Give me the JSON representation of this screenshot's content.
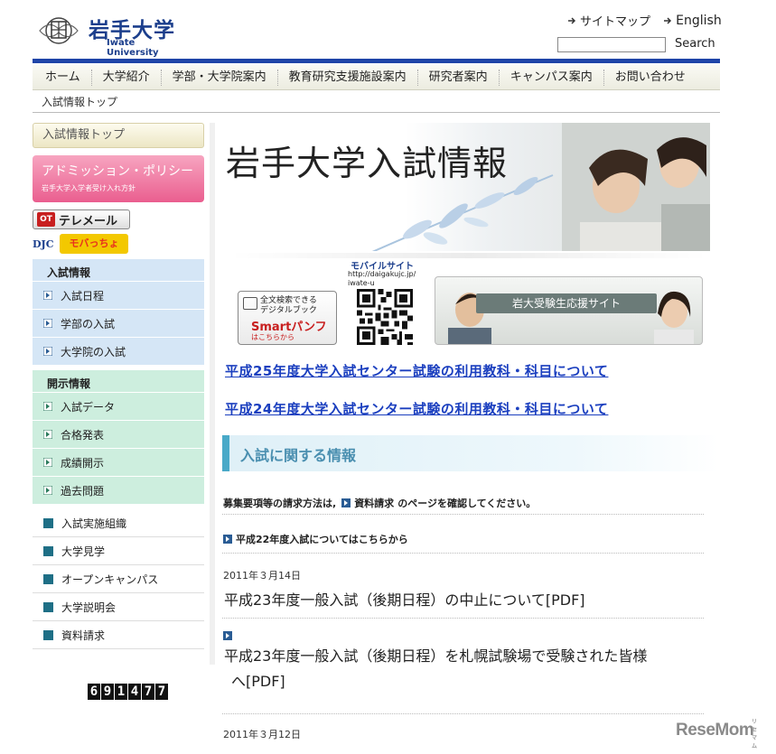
{
  "header": {
    "logo_jp": "岩手大学",
    "logo_en": "Iwate University",
    "links": [
      "サイトマップ",
      "English"
    ],
    "search_label": "Search"
  },
  "gnav": [
    "ホーム",
    "大学紹介",
    "学部・大学院案内",
    "教育研究支援施設案内",
    "研究者案内",
    "キャンパス案内",
    "お問い合わせ"
  ],
  "breadcrumb": "入試情報トップ",
  "sidebar": {
    "top": "入試情報トップ",
    "policy_title": "アドミッション・ポリシー",
    "policy_sub": "岩手大学入学者受け入れ方針",
    "telemail_icon": "OT",
    "telemail": "テレメール",
    "djc": "DJC",
    "mobile_logo": "モバっちょ",
    "group1": {
      "head": "入試情報",
      "items": [
        "入試日程",
        "学部の入試",
        "大学院の入試"
      ]
    },
    "group2": {
      "head": "開示情報",
      "items": [
        "入試データ",
        "合格発表",
        "成績開示",
        "過去問題"
      ]
    },
    "plain": [
      "入試実施組織",
      "大学見学",
      "オープンキャンパス",
      "大学説明会",
      "資料請求"
    ],
    "counter": [
      "6",
      "9",
      "1",
      "4",
      "7",
      "7"
    ]
  },
  "main": {
    "hero_title": "岩手大学入試情報",
    "qr_label": "モバイルサイト",
    "qr_url_1": "http://daigakujc.jp/",
    "qr_url_2": "iwate-u",
    "smart_line1": "全文検索できる",
    "smart_line2": "デジタルブック",
    "smart_title": "Smartパンフ",
    "smart_more": "はこちらから",
    "support_text": "岩大受験生応援サイト",
    "notice1": "平成25年度大学入試センター試験の利用教科・科目について",
    "notice2": "平成24年度大学入試センター試験の利用教科・科目について",
    "section_title": "入試に関する情報",
    "request_pre": "募集要項等の請求方法は,",
    "request_link": "資料請求",
    "request_post": "のページを確認してください。",
    "h22": "平成22年度入試についてはこちらから",
    "news": [
      {
        "date": "2011年３月14日",
        "title": "平成23年度一般入試（後期日程）の中止について[PDF]"
      },
      {
        "title_1": "平成23年度一般入試（後期日程）を札幌試験場で受験された皆様",
        "title_2": "へ[PDF]"
      },
      {
        "date": "2011年３月12日"
      }
    ]
  },
  "watermark": {
    "main": "ReseMom",
    "sub": "リセマム"
  },
  "colors": {
    "brand_blue": "#1f45a8",
    "link_blue": "#1b3fbf",
    "policy_pink": "#ea5e8f",
    "section_cyan": "#49a9c8"
  }
}
